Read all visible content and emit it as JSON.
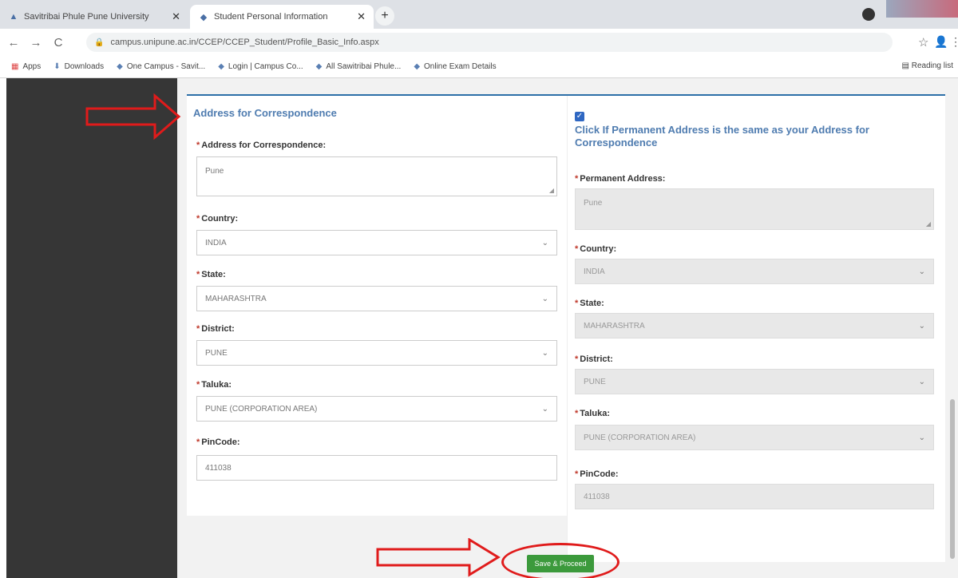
{
  "browser": {
    "tabs": [
      {
        "title": "Savitribai Phule Pune University"
      },
      {
        "title": "Student Personal Information"
      }
    ],
    "new_tab": "+",
    "url": "campus.unipune.ac.in/CCEP/CCEP_Student/Profile_Basic_Info.aspx",
    "bookmarks": [
      {
        "label": "Apps",
        "icon": "apps-grid-icon"
      },
      {
        "label": "Downloads",
        "icon": "download-icon"
      },
      {
        "label": "One Campus - Savit...",
        "icon": "site-icon"
      },
      {
        "label": "Login | Campus Co...",
        "icon": "site-icon"
      },
      {
        "label": "All Sawitribai Phule...",
        "icon": "site-icon"
      },
      {
        "label": "Online Exam Details",
        "icon": "site-icon"
      }
    ],
    "reading_list": "Reading list"
  },
  "correspondence": {
    "section_title": "Address for Correspondence",
    "address_label": "Address for Correspondence:",
    "address_value": "Pune",
    "country_label": "Country:",
    "country_value": "INDIA",
    "state_label": "State:",
    "state_value": "MAHARASHTRA",
    "district_label": "District:",
    "district_value": "PUNE",
    "taluka_label": "Taluka:",
    "taluka_value": "PUNE (CORPORATION AREA)",
    "pincode_label": "PinCode:",
    "pincode_value": "411038"
  },
  "permanent": {
    "same_as_checkbox_checked": true,
    "same_as_text": "Click If Permanent Address is the same as your Address for Correspondence",
    "address_label": "Permanent Address:",
    "address_value": "Pune",
    "country_label": "Country:",
    "country_value": "INDIA",
    "state_label": "State:",
    "state_value": "MAHARASHTRA",
    "district_label": "District:",
    "district_value": "PUNE",
    "taluka_label": "Taluka:",
    "taluka_value": "PUNE (CORPORATION AREA)",
    "pincode_label": "PinCode:",
    "pincode_value": "411038"
  },
  "actions": {
    "save_label": "Save & Proceed"
  },
  "colors": {
    "accent": "#4f7cb0",
    "save_button": "#3c9a3c",
    "annotation_red": "#e01b1b",
    "sidebar": "#363636"
  }
}
